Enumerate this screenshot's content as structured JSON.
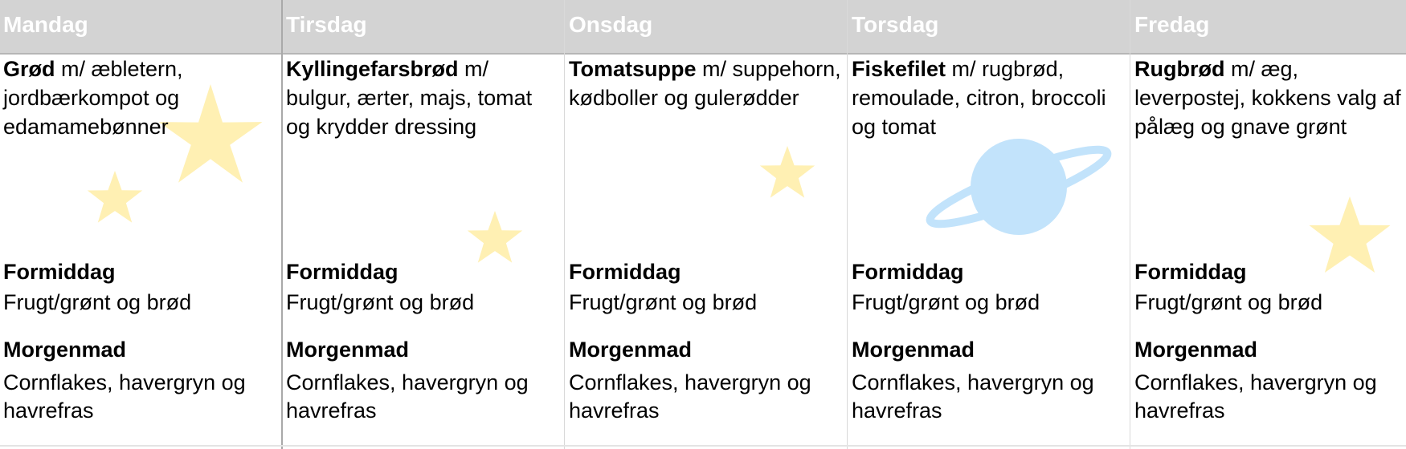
{
  "days": [
    {
      "name": "Mandag",
      "lunch_dish": "Grød",
      "lunch_rest": " m/ æbletern, jordbærkompot og edamamebønner",
      "snack_title": "Formiddag",
      "snack_text": "Frugt/grønt og brød",
      "breakfast_title": "Morgenmad",
      "breakfast_text": "Cornflakes, havergryn og havrefras"
    },
    {
      "name": "Tirsdag",
      "lunch_dish": "Kyllingefarsbrød",
      "lunch_rest": " m/ bulgur, ærter, majs, tomat og krydder dressing",
      "snack_title": "Formiddag",
      "snack_text": "Frugt/grønt og brød",
      "breakfast_title": "Morgenmad",
      "breakfast_text": "Cornflakes, havergryn og havrefras"
    },
    {
      "name": "Onsdag",
      "lunch_dish": "Tomatsuppe",
      "lunch_rest": " m/ suppehorn, kødboller og gulerødder",
      "snack_title": "Formiddag",
      "snack_text": "Frugt/grønt og brød",
      "breakfast_title": "Morgenmad",
      "breakfast_text": "Cornflakes, havergryn og havrefras"
    },
    {
      "name": "Torsdag",
      "lunch_dish": "Fiskefilet",
      "lunch_rest": " m/ rugbrød, remoulade, citron, broccoli og tomat",
      "snack_title": "Formiddag",
      "snack_text": "Frugt/grønt og brød",
      "breakfast_title": "Morgenmad",
      "breakfast_text": "Cornflakes, havergryn og havrefras"
    },
    {
      "name": "Fredag",
      "lunch_dish": "Rugbrød",
      "lunch_rest": " m/ æg, leverpostej, kokkens valg af pålæg og gnave grønt",
      "snack_title": "Formiddag",
      "snack_text": "Frugt/grønt og brød",
      "breakfast_title": "Morgenmad",
      "breakfast_text": "Cornflakes, havergryn og havrefras"
    }
  ],
  "colors": {
    "header_bg": "#d3d3d3",
    "header_text": "#ffffff",
    "star": "#fff0b3",
    "planet": "#c2e3fb"
  },
  "decorations": [
    "star-icon",
    "planet-icon"
  ]
}
